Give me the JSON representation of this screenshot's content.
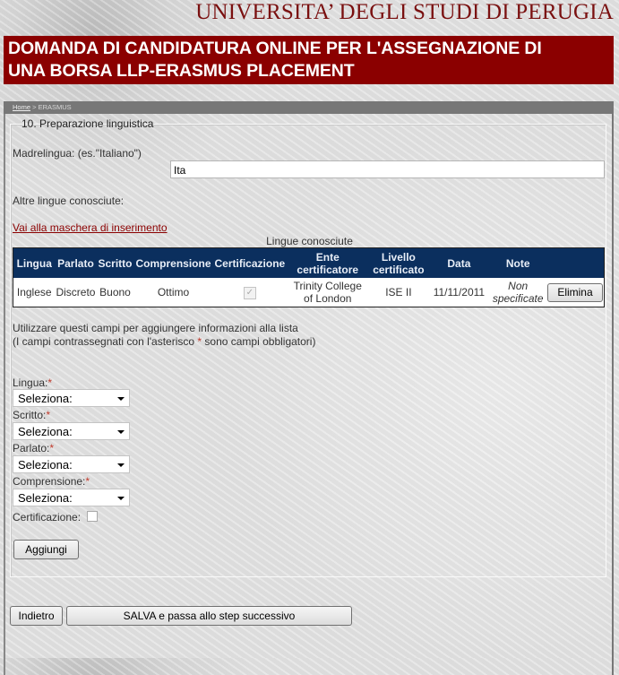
{
  "header": {
    "university": "UNIVERSITA’ DEGLI STUDI DI PERUGIA",
    "banner_line1": "DOMANDA DI CANDIDATURA ONLINE PER L'ASSEGNAZIONE DI",
    "banner_line2": "UNA BORSA LLP-ERASMUS PLACEMENT"
  },
  "breadcrumb": {
    "home": "Home",
    "separator": " > ",
    "current": "ERASMUS"
  },
  "section": {
    "legend": "10. Preparazione linguistica",
    "madrelingua_label": "Madrelingua: (es.\"Italiano\")",
    "madrelingua_value": "Ita",
    "altre_label": "Altre lingue conosciute:",
    "insert_link": "Vai alla maschera di inserimento",
    "table_caption": "Lingue conosciute"
  },
  "table": {
    "headers": [
      "Lingua",
      "Parlato",
      "Scritto",
      "Comprensione",
      "Certificazione",
      "Ente certificatore",
      "Livello certificato",
      "Data",
      "Note",
      ""
    ],
    "rows": [
      {
        "lingua": "Inglese",
        "parlato": "Discreto",
        "scritto": "Buono",
        "comprensione": "Ottimo",
        "certificazione": true,
        "ente": "Trinity College of London",
        "livello": "ISE II",
        "data": "11/11/2011",
        "note": "Non specificate",
        "action": "Elimina"
      }
    ]
  },
  "form": {
    "info_line1": "Utilizzare questi campi per aggiungere informazioni alla lista",
    "info_line2_pre": "(I campi contrassegnati con l'asterisco ",
    "asterisk": "*",
    "info_line2_post": " sono campi obbligatori)",
    "fields": [
      {
        "label": "Lingua:",
        "value": "Seleziona:"
      },
      {
        "label": "Scritto:",
        "value": "Seleziona:"
      },
      {
        "label": "Parlato:",
        "value": "Seleziona:"
      },
      {
        "label": "Comprensione:",
        "value": "Seleziona:"
      }
    ],
    "cert_label": "Certificazione:",
    "cert_checked": false,
    "add_button": "Aggiungi"
  },
  "nav": {
    "back_button": "Indietro",
    "save_button": "SALVA e passa allo step successivo"
  },
  "colors": {
    "banner": "#8b0000",
    "title": "#7a1010",
    "table_header": "#0b2f5e",
    "link": "#8b0000",
    "required": "#c0392b"
  }
}
